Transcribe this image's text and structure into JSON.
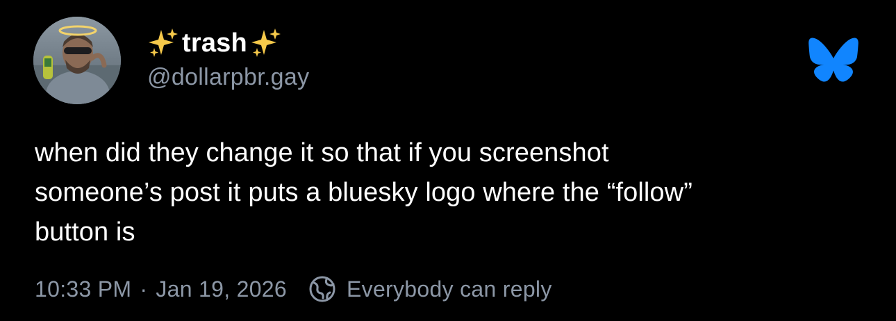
{
  "post": {
    "author": {
      "display_name": "trash",
      "display_name_emoji": "sparkles-emoji",
      "handle": "@dollarpbr.gay",
      "avatar": "profile-photo"
    },
    "logo": "bluesky-butterfly-icon",
    "text_lines": [
      "when did they change it so that if you screenshot",
      "someone’s post it puts a bluesky logo where the “follow”",
      "button is"
    ],
    "time": "10:33 PM",
    "separator": "·",
    "date": "Jan 19, 2026",
    "reply_setting_icon": "globe-icon",
    "reply_setting": "Everybody can reply"
  },
  "colors": {
    "background": "#000000",
    "text": "#ffffff",
    "muted": "#8c97a6",
    "bluesky_blue": "#1185fe"
  }
}
